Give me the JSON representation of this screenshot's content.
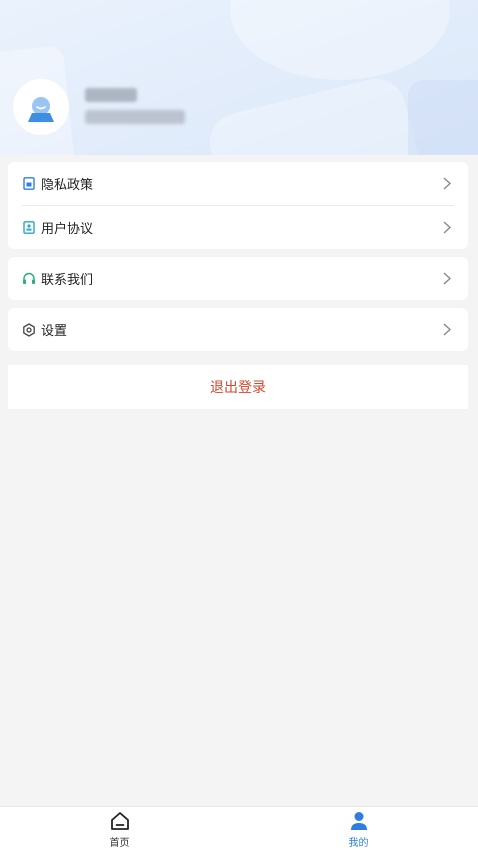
{
  "header": {
    "username": "",
    "phone": ""
  },
  "menu": {
    "privacy_label": "隐私政策",
    "agreement_label": "用户协议",
    "contact_label": "联系我们",
    "settings_label": "设置"
  },
  "logout_label": "退出登录",
  "tabbar": {
    "home_label": "首页",
    "mine_label": "我的"
  },
  "colors": {
    "accent": "#2f7de0",
    "logout": "#d4482c",
    "contact_icon": "#27b07a"
  }
}
